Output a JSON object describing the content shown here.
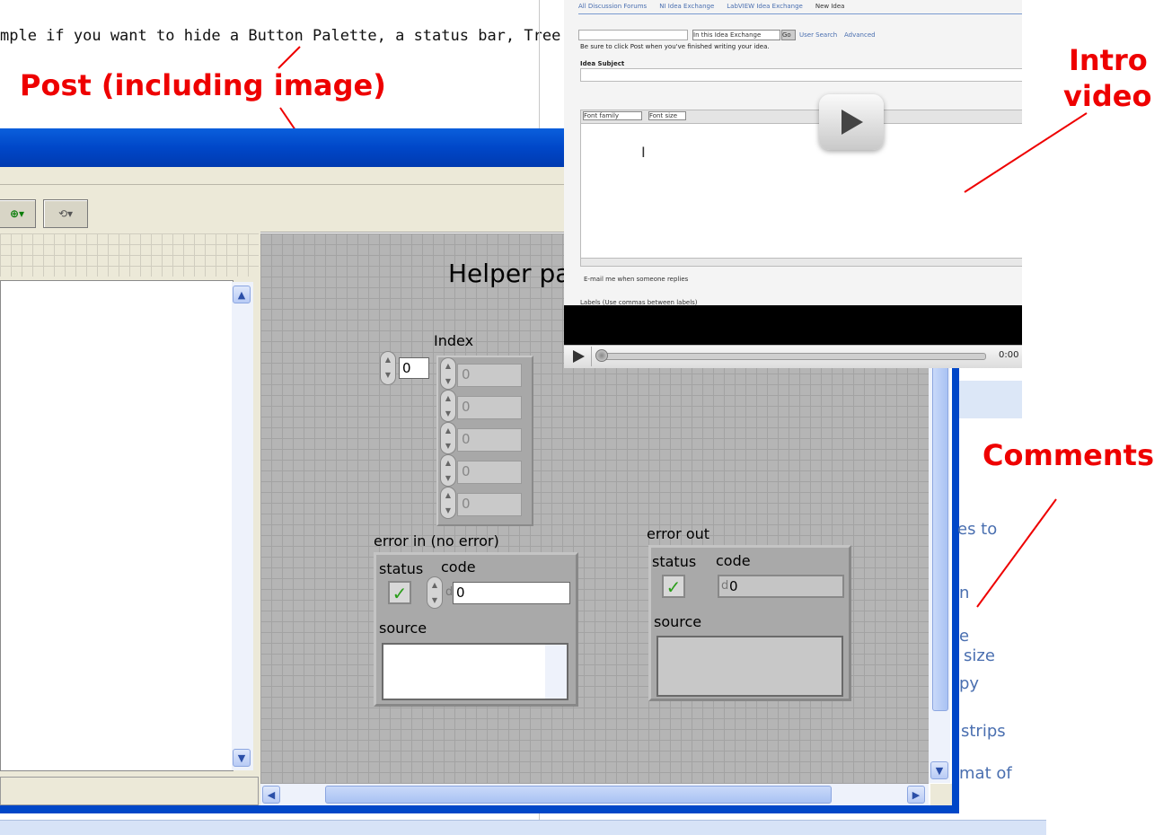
{
  "post": {
    "text": "mple if you want to hide a Button Palette, a status bar, Tree"
  },
  "annotations": {
    "post": "Post (including image)",
    "intro_line1": "Intro",
    "intro_line2": "video",
    "comments": "Comments"
  },
  "labview": {
    "panel_title": "Helper pa",
    "index_label": "Index",
    "index_value": "0",
    "array_values": [
      "0",
      "0",
      "0",
      "0",
      "0"
    ],
    "error_in": {
      "label": "error in (no error)",
      "status_label": "status",
      "code_label": "code",
      "code_prefix": "d",
      "code_value": "0",
      "source_label": "source"
    },
    "error_out": {
      "label": "error out",
      "status_label": "status",
      "code_label": "code",
      "code_prefix": "d",
      "code_value": "0",
      "source_label": "source"
    }
  },
  "video": {
    "breadcrumb": [
      "All Discussion Forums",
      "NI Idea Exchange",
      "LabVIEW Idea Exchange",
      "New Idea"
    ],
    "search_scope": "In this Idea Exchange",
    "search_go": "Go",
    "user_search": "User Search",
    "advanced": "Advanced",
    "instruction": "Be sure to click Post when you've finished writing your idea.",
    "idea_subject_label": "Idea Subject",
    "font_family": "Font family",
    "font_size": "Font size",
    "email_option": "E-mail me when someone replies",
    "labels_hint": "Labels (Use commas between labels)",
    "time": "0:00"
  },
  "comments_fragments": [
    "es to",
    "n",
    "e",
    "size",
    "py",
    "strips",
    "mat of"
  ]
}
